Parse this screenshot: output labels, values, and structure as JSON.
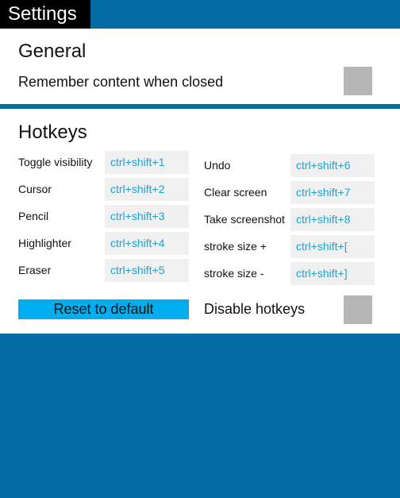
{
  "window": {
    "title": "Settings"
  },
  "general": {
    "title": "General",
    "remember_label": "Remember content when closed",
    "remember_checked": false
  },
  "hotkeys": {
    "title": "Hotkeys",
    "left": [
      {
        "label": "Toggle visibility",
        "value": "ctrl+shift+1"
      },
      {
        "label": "Cursor",
        "value": "ctrl+shift+2"
      },
      {
        "label": "Pencil",
        "value": "ctrl+shift+3"
      },
      {
        "label": "Highlighter",
        "value": "ctrl+shift+4"
      },
      {
        "label": "Eraser",
        "value": "ctrl+shift+5"
      }
    ],
    "right": [
      {
        "label": "Undo",
        "value": "ctrl+shift+6"
      },
      {
        "label": "Clear screen",
        "value": "ctrl+shift+7"
      },
      {
        "label": "Take screenshot",
        "value": "ctrl+shift+8"
      },
      {
        "label": "stroke size +",
        "value": "ctrl+shift+["
      },
      {
        "label": "stroke size -",
        "value": "ctrl+shift+]"
      }
    ],
    "reset_label": "Reset to default",
    "disable_label": "Disable hotkeys",
    "disable_checked": false
  },
  "colors": {
    "background": "#026ba1",
    "accent_button": "#00adef",
    "hotkey_text": "#1aa3d9",
    "checkbox": "#b6b6b6"
  }
}
